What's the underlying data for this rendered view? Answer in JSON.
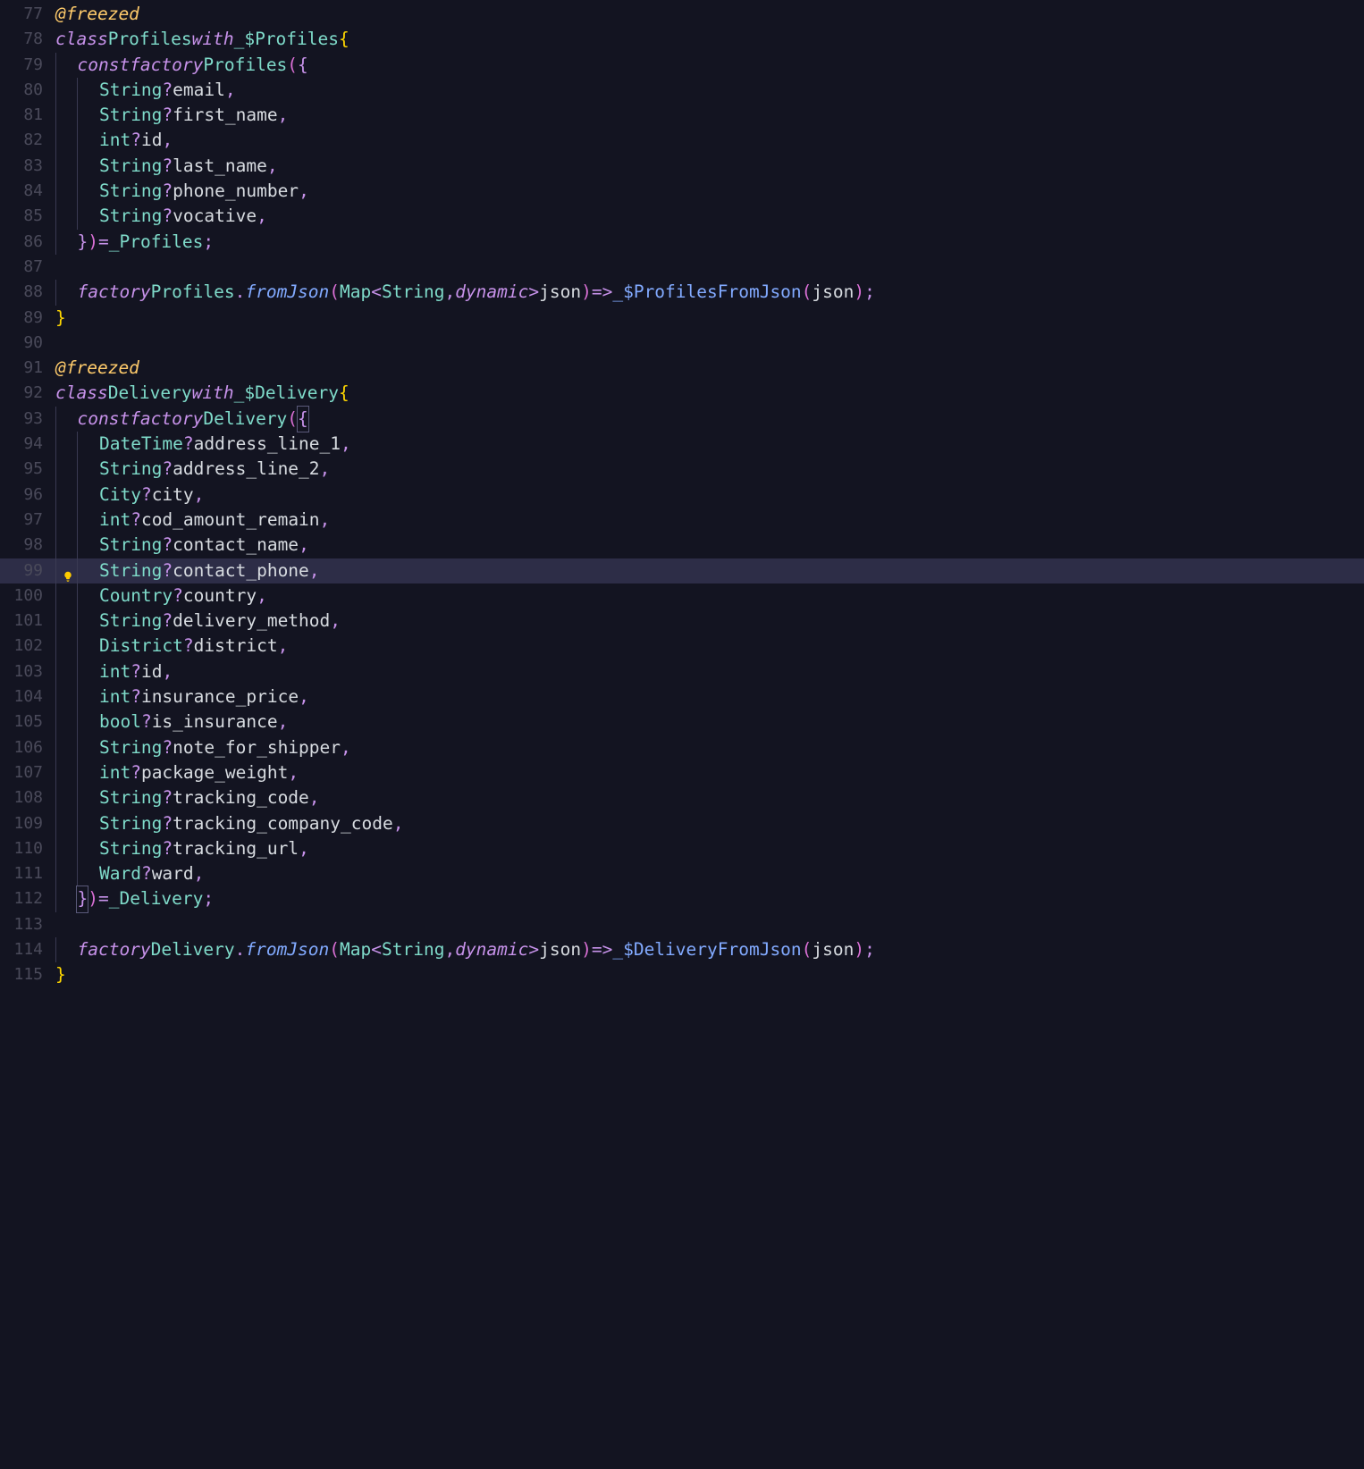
{
  "lines": [
    {
      "num": "77",
      "indent": 0,
      "tokens": [
        [
          "annotation",
          "@freezed"
        ]
      ]
    },
    {
      "num": "78",
      "indent": 0,
      "tokens": [
        [
          "keyword",
          "class"
        ],
        [
          "ws",
          " "
        ],
        [
          "type",
          "Profiles"
        ],
        [
          "ws",
          " "
        ],
        [
          "keyword",
          "with"
        ],
        [
          "ws",
          " "
        ],
        [
          "type",
          "_$Profiles"
        ],
        [
          "ws",
          " "
        ],
        [
          "paren",
          "{"
        ]
      ]
    },
    {
      "num": "79",
      "indent": 1,
      "tokens": [
        [
          "keyword",
          "const"
        ],
        [
          "ws",
          " "
        ],
        [
          "keyword",
          "factory"
        ],
        [
          "ws",
          " "
        ],
        [
          "type",
          "Profiles"
        ],
        [
          "paren2",
          "("
        ],
        [
          "brace",
          "{"
        ]
      ]
    },
    {
      "num": "80",
      "indent": 2,
      "tokens": [
        [
          "type",
          "String"
        ],
        [
          "question",
          "?"
        ],
        [
          "ws",
          " "
        ],
        [
          "param",
          "email"
        ],
        [
          "comma",
          ","
        ]
      ]
    },
    {
      "num": "81",
      "indent": 2,
      "tokens": [
        [
          "type",
          "String"
        ],
        [
          "question",
          "?"
        ],
        [
          "ws",
          " "
        ],
        [
          "param",
          "first_name"
        ],
        [
          "comma",
          ","
        ]
      ]
    },
    {
      "num": "82",
      "indent": 2,
      "tokens": [
        [
          "type",
          "int"
        ],
        [
          "question",
          "?"
        ],
        [
          "ws",
          " "
        ],
        [
          "param",
          "id"
        ],
        [
          "comma",
          ","
        ]
      ]
    },
    {
      "num": "83",
      "indent": 2,
      "tokens": [
        [
          "type",
          "String"
        ],
        [
          "question",
          "?"
        ],
        [
          "ws",
          " "
        ],
        [
          "param",
          "last_name"
        ],
        [
          "comma",
          ","
        ]
      ]
    },
    {
      "num": "84",
      "indent": 2,
      "tokens": [
        [
          "type",
          "String"
        ],
        [
          "question",
          "?"
        ],
        [
          "ws",
          " "
        ],
        [
          "param",
          "phone_number"
        ],
        [
          "comma",
          ","
        ]
      ]
    },
    {
      "num": "85",
      "indent": 2,
      "tokens": [
        [
          "type",
          "String"
        ],
        [
          "question",
          "?"
        ],
        [
          "ws",
          " "
        ],
        [
          "param",
          "vocative"
        ],
        [
          "comma",
          ","
        ]
      ]
    },
    {
      "num": "86",
      "indent": 1,
      "tokens": [
        [
          "brace",
          "}"
        ],
        [
          "paren2",
          ")"
        ],
        [
          "ws",
          " "
        ],
        [
          "assign",
          "="
        ],
        [
          "ws",
          " "
        ],
        [
          "type",
          "_Profiles"
        ],
        [
          "semicolon",
          ";"
        ]
      ]
    },
    {
      "num": "87",
      "indent": 0,
      "tokens": []
    },
    {
      "num": "88",
      "indent": 1,
      "tokens": [
        [
          "keyword",
          "factory"
        ],
        [
          "ws",
          " "
        ],
        [
          "type",
          "Profiles"
        ],
        [
          "dot",
          "."
        ],
        [
          "method",
          "fromJson"
        ],
        [
          "paren2",
          "("
        ],
        [
          "type",
          "Map"
        ],
        [
          "angle",
          "<"
        ],
        [
          "type",
          "String"
        ],
        [
          "comma",
          ","
        ],
        [
          "ws",
          " "
        ],
        [
          "keyword",
          "dynamic"
        ],
        [
          "angle",
          ">"
        ],
        [
          "ws",
          " "
        ],
        [
          "param",
          "json"
        ],
        [
          "paren2",
          ")"
        ],
        [
          "ws",
          " "
        ],
        [
          "operator",
          "=>"
        ],
        [
          "ws",
          " "
        ],
        [
          "func",
          "_$ProfilesFromJson"
        ],
        [
          "paren2",
          "("
        ],
        [
          "param",
          "json"
        ],
        [
          "paren2",
          ")"
        ],
        [
          "semicolon",
          ";"
        ]
      ]
    },
    {
      "num": "89",
      "indent": 0,
      "tokens": [
        [
          "paren",
          "}"
        ]
      ]
    },
    {
      "num": "90",
      "indent": 0,
      "tokens": []
    },
    {
      "num": "91",
      "indent": 0,
      "tokens": [
        [
          "annotation",
          "@freezed"
        ]
      ]
    },
    {
      "num": "92",
      "indent": 0,
      "tokens": [
        [
          "keyword",
          "class"
        ],
        [
          "ws",
          " "
        ],
        [
          "type",
          "Delivery"
        ],
        [
          "ws",
          " "
        ],
        [
          "keyword",
          "with"
        ],
        [
          "ws",
          " "
        ],
        [
          "type",
          "_$Delivery"
        ],
        [
          "ws",
          " "
        ],
        [
          "paren",
          "{"
        ]
      ]
    },
    {
      "num": "93",
      "indent": 1,
      "tokens": [
        [
          "keyword",
          "const"
        ],
        [
          "ws",
          " "
        ],
        [
          "keyword",
          "factory"
        ],
        [
          "ws",
          " "
        ],
        [
          "type",
          "Delivery"
        ],
        [
          "paren2",
          "("
        ],
        [
          "brace-matched",
          "{"
        ]
      ]
    },
    {
      "num": "94",
      "indent": 2,
      "tokens": [
        [
          "type",
          "DateTime"
        ],
        [
          "question",
          "?"
        ],
        [
          "ws",
          " "
        ],
        [
          "param",
          "address_line_1"
        ],
        [
          "comma",
          ","
        ]
      ]
    },
    {
      "num": "95",
      "indent": 2,
      "tokens": [
        [
          "type",
          "String"
        ],
        [
          "question",
          "?"
        ],
        [
          "ws",
          " "
        ],
        [
          "param",
          "address_line_2"
        ],
        [
          "comma",
          ","
        ]
      ]
    },
    {
      "num": "96",
      "indent": 2,
      "tokens": [
        [
          "type",
          "City"
        ],
        [
          "question",
          "?"
        ],
        [
          "ws",
          " "
        ],
        [
          "param",
          "city"
        ],
        [
          "comma",
          ","
        ]
      ]
    },
    {
      "num": "97",
      "indent": 2,
      "tokens": [
        [
          "type",
          "int"
        ],
        [
          "question",
          "?"
        ],
        [
          "ws",
          " "
        ],
        [
          "param",
          "cod_amount_remain"
        ],
        [
          "comma",
          ","
        ]
      ]
    },
    {
      "num": "98",
      "indent": 2,
      "tokens": [
        [
          "type",
          "String"
        ],
        [
          "question",
          "?"
        ],
        [
          "ws",
          " "
        ],
        [
          "param",
          "contact_name"
        ],
        [
          "comma",
          ","
        ]
      ]
    },
    {
      "num": "99",
      "indent": 2,
      "highlighted": true,
      "bulb": true,
      "tokens": [
        [
          "type",
          "String"
        ],
        [
          "question",
          "?"
        ],
        [
          "ws",
          " "
        ],
        [
          "param",
          "contact_phone"
        ],
        [
          "comma",
          ","
        ]
      ]
    },
    {
      "num": "100",
      "indent": 2,
      "tokens": [
        [
          "type",
          "Country"
        ],
        [
          "question",
          "?"
        ],
        [
          "ws",
          " "
        ],
        [
          "param",
          "country"
        ],
        [
          "comma",
          ","
        ]
      ]
    },
    {
      "num": "101",
      "indent": 2,
      "tokens": [
        [
          "type",
          "String"
        ],
        [
          "question",
          "?"
        ],
        [
          "ws",
          " "
        ],
        [
          "param",
          "delivery_method"
        ],
        [
          "comma",
          ","
        ]
      ]
    },
    {
      "num": "102",
      "indent": 2,
      "tokens": [
        [
          "type",
          "District"
        ],
        [
          "question",
          "?"
        ],
        [
          "ws",
          " "
        ],
        [
          "param",
          "district"
        ],
        [
          "comma",
          ","
        ]
      ]
    },
    {
      "num": "103",
      "indent": 2,
      "tokens": [
        [
          "type",
          "int"
        ],
        [
          "question",
          "?"
        ],
        [
          "ws",
          " "
        ],
        [
          "param",
          "id"
        ],
        [
          "comma",
          ","
        ]
      ]
    },
    {
      "num": "104",
      "indent": 2,
      "tokens": [
        [
          "type",
          "int"
        ],
        [
          "question",
          "?"
        ],
        [
          "ws",
          " "
        ],
        [
          "param",
          "insurance_price"
        ],
        [
          "comma",
          ","
        ]
      ]
    },
    {
      "num": "105",
      "indent": 2,
      "tokens": [
        [
          "type",
          "bool"
        ],
        [
          "question",
          "?"
        ],
        [
          "ws",
          " "
        ],
        [
          "param",
          "is_insurance"
        ],
        [
          "comma",
          ","
        ]
      ]
    },
    {
      "num": "106",
      "indent": 2,
      "tokens": [
        [
          "type",
          "String"
        ],
        [
          "question",
          "?"
        ],
        [
          "ws",
          " "
        ],
        [
          "param",
          "note_for_shipper"
        ],
        [
          "comma",
          ","
        ]
      ]
    },
    {
      "num": "107",
      "indent": 2,
      "tokens": [
        [
          "type",
          "int"
        ],
        [
          "question",
          "?"
        ],
        [
          "ws",
          " "
        ],
        [
          "param",
          "package_weight"
        ],
        [
          "comma",
          ","
        ]
      ]
    },
    {
      "num": "108",
      "indent": 2,
      "tokens": [
        [
          "type",
          "String"
        ],
        [
          "question",
          "?"
        ],
        [
          "ws",
          " "
        ],
        [
          "param",
          "tracking_code"
        ],
        [
          "comma",
          ","
        ]
      ]
    },
    {
      "num": "109",
      "indent": 2,
      "tokens": [
        [
          "type",
          "String"
        ],
        [
          "question",
          "?"
        ],
        [
          "ws",
          " "
        ],
        [
          "param",
          "tracking_company_code"
        ],
        [
          "comma",
          ","
        ]
      ]
    },
    {
      "num": "110",
      "indent": 2,
      "tokens": [
        [
          "type",
          "String"
        ],
        [
          "question",
          "?"
        ],
        [
          "ws",
          " "
        ],
        [
          "param",
          "tracking_url"
        ],
        [
          "comma",
          ","
        ]
      ]
    },
    {
      "num": "111",
      "indent": 2,
      "tokens": [
        [
          "type",
          "Ward"
        ],
        [
          "question",
          "?"
        ],
        [
          "ws",
          " "
        ],
        [
          "param",
          "ward"
        ],
        [
          "comma",
          ","
        ]
      ]
    },
    {
      "num": "112",
      "indent": 1,
      "tokens": [
        [
          "brace-matched",
          "}"
        ],
        [
          "paren2",
          ")"
        ],
        [
          "ws",
          " "
        ],
        [
          "assign",
          "="
        ],
        [
          "ws",
          " "
        ],
        [
          "type",
          "_Delivery"
        ],
        [
          "semicolon",
          ";"
        ]
      ]
    },
    {
      "num": "113",
      "indent": 0,
      "tokens": []
    },
    {
      "num": "114",
      "indent": 1,
      "tokens": [
        [
          "keyword",
          "factory"
        ],
        [
          "ws",
          " "
        ],
        [
          "type",
          "Delivery"
        ],
        [
          "dot",
          "."
        ],
        [
          "method",
          "fromJson"
        ],
        [
          "paren2",
          "("
        ],
        [
          "type",
          "Map"
        ],
        [
          "angle",
          "<"
        ],
        [
          "type",
          "String"
        ],
        [
          "comma",
          ","
        ],
        [
          "ws",
          " "
        ],
        [
          "keyword",
          "dynamic"
        ],
        [
          "angle",
          ">"
        ],
        [
          "ws",
          " "
        ],
        [
          "param",
          "json"
        ],
        [
          "paren2",
          ")"
        ],
        [
          "ws",
          " "
        ],
        [
          "operator",
          "=>"
        ],
        [
          "ws",
          " "
        ],
        [
          "func",
          "_$DeliveryFromJson"
        ],
        [
          "paren2",
          "("
        ],
        [
          "param",
          "json"
        ],
        [
          "paren2",
          ")"
        ],
        [
          "semicolon",
          ";"
        ]
      ]
    },
    {
      "num": "115",
      "indent": 0,
      "tokens": [
        [
          "paren",
          "}"
        ]
      ]
    }
  ]
}
